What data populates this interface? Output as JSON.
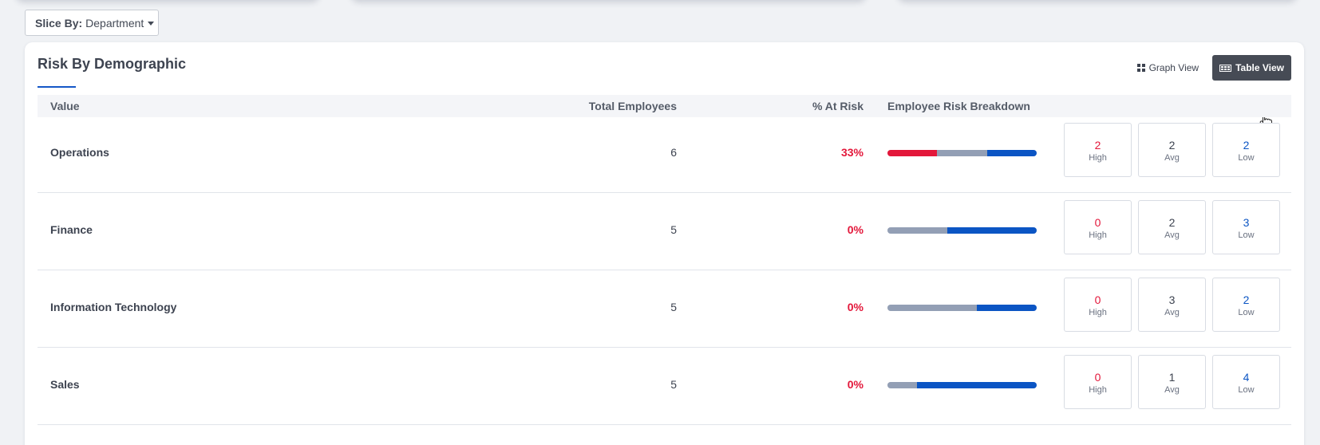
{
  "slice": {
    "label": "Slice By:",
    "value": "Department"
  },
  "panel": {
    "title": "Risk By Demographic",
    "graph_view": "Graph View",
    "table_view": "Table View"
  },
  "table": {
    "headers": {
      "value": "Value",
      "total": "Total Employees",
      "pct": "% At Risk",
      "breakdown": "Employee Risk Breakdown"
    },
    "rows": [
      {
        "value": "Operations",
        "total": "6",
        "pct": "33%",
        "high": "2",
        "avg": "2",
        "low": "2"
      },
      {
        "value": "Finance",
        "total": "5",
        "pct": "0%",
        "high": "0",
        "avg": "2",
        "low": "3"
      },
      {
        "value": "Information Technology",
        "total": "5",
        "pct": "0%",
        "high": "0",
        "avg": "3",
        "low": "2"
      },
      {
        "value": "Sales",
        "total": "5",
        "pct": "0%",
        "high": "0",
        "avg": "1",
        "low": "4"
      }
    ],
    "box_labels": {
      "high": "High",
      "avg": "Avg",
      "low": "Low"
    }
  },
  "colors": {
    "high": "#e3173a",
    "avg": "#939fb5",
    "low": "#0b55c4",
    "accent": "#1457c7"
  }
}
